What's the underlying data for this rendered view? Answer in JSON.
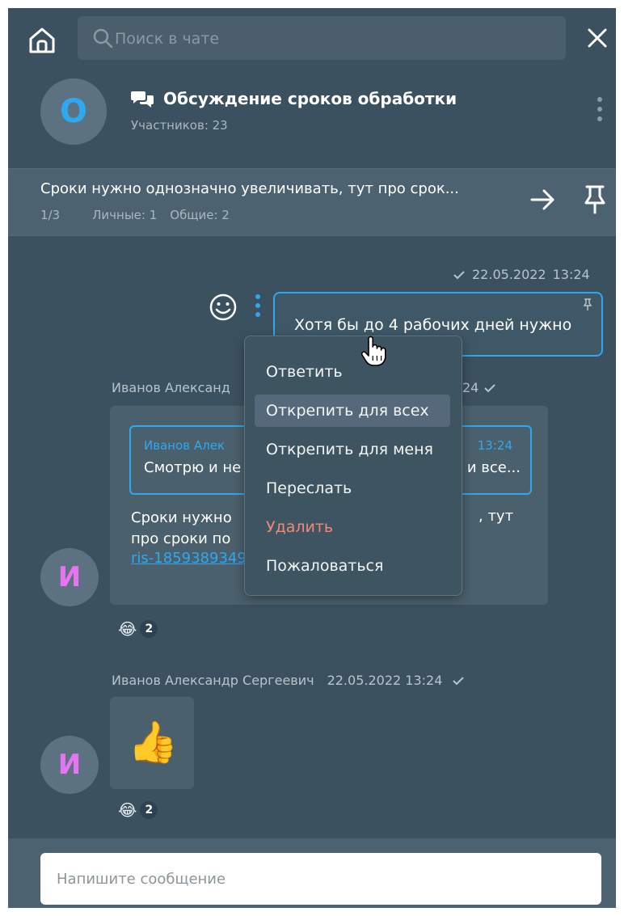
{
  "search": {
    "placeholder": "Поиск в чате"
  },
  "chat": {
    "avatar_letter": "О",
    "title": "Обсуждение сроков обработки",
    "members": "Участников: 23"
  },
  "pinned": {
    "text": "Сроки нужно однозначно увеличивать, тут про срок...",
    "counter": "1/3",
    "personal": "Личные: 1",
    "common": "Общие: 2"
  },
  "own_message": {
    "date": "22.05.2022",
    "time": "13:24",
    "text": "Хотя бы до 4 рабочих дней нужно"
  },
  "message1": {
    "author_visible": "Иванов Александ",
    "time_tail": "24",
    "avatar_letter": "И",
    "quote_author": "Иванов Алек",
    "quote_time": "13:24",
    "quote_text": "Смотрю и не",
    "quote_text_end": "и все...",
    "text_line1": "Сроки нужно",
    "text_line1_end": ", тут",
    "text_line2": "про сроки по",
    "link": "ris-1859389349",
    "reaction_emoji": "😂",
    "reaction_count": "2"
  },
  "message2": {
    "author": "Иванов Александр Сергеевич",
    "datetime": "22.05.2022  13:24",
    "avatar_letter": "И",
    "sticker": "👍",
    "reaction_emoji": "😂",
    "reaction_count": "2"
  },
  "context_menu": {
    "items": [
      {
        "label": "Ответить"
      },
      {
        "label": "Открепить для всех"
      },
      {
        "label": "Открепить для меня"
      },
      {
        "label": "Переслать"
      },
      {
        "label": "Удалить"
      },
      {
        "label": "Пожаловаться"
      }
    ]
  },
  "compose": {
    "placeholder": "Напишите сообщение"
  },
  "colors": {
    "background": "#3c5160",
    "accent": "#2fa8ef",
    "danger": "#ee8a79",
    "avatar_letter_user": "#e873f3"
  },
  "icons": [
    "home-icon",
    "search-icon",
    "close-icon",
    "group-chat-icon",
    "more-vertical-icon",
    "arrow-right-icon",
    "pin-icon",
    "check-icon",
    "smile-icon",
    "hand-cursor-icon"
  ]
}
